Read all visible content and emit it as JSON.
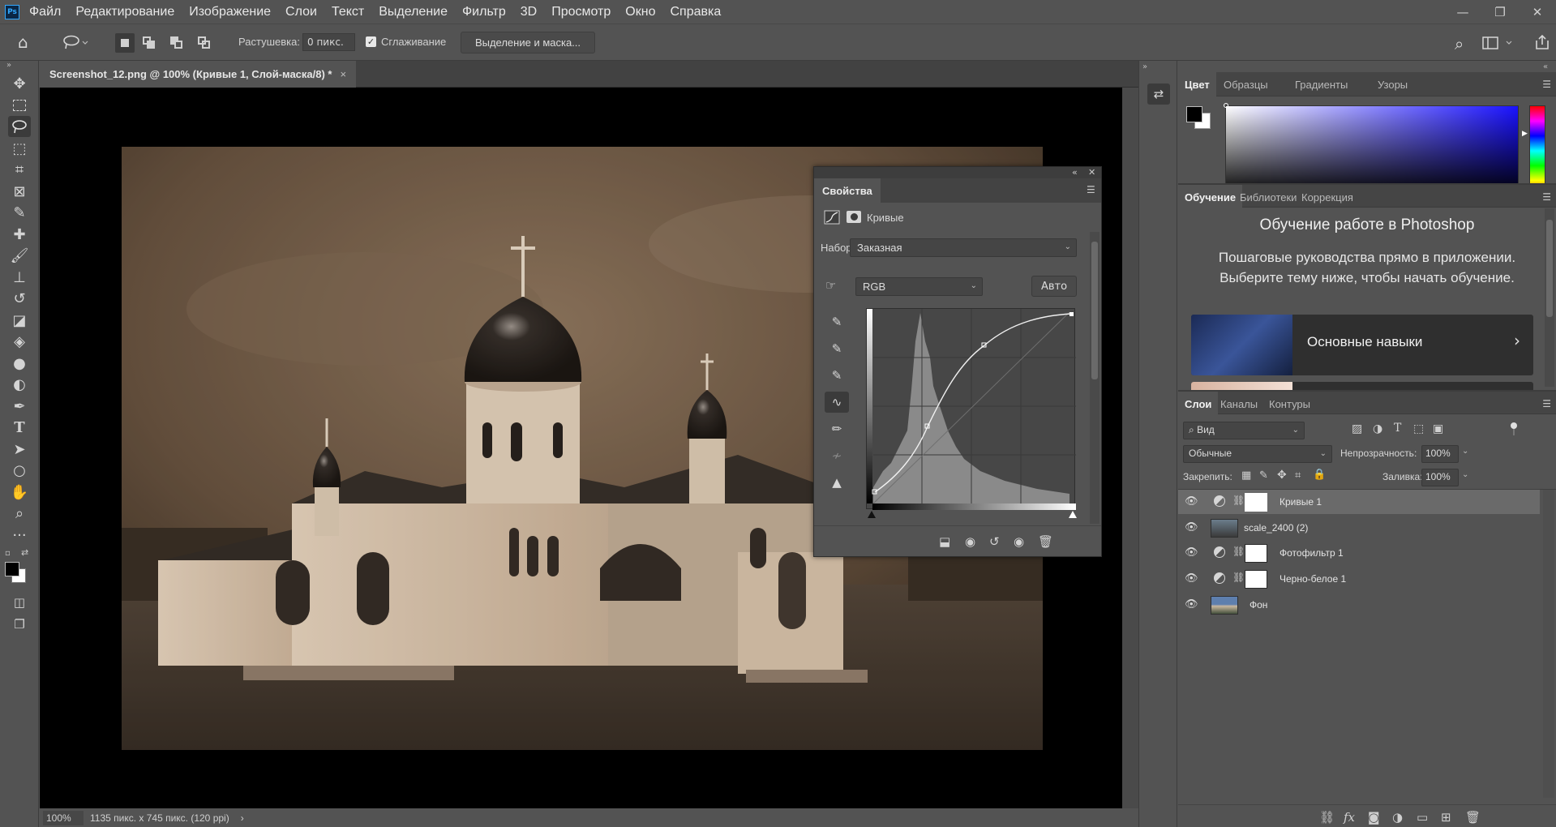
{
  "app": {
    "logo_text": "Ps"
  },
  "menu": [
    "Файл",
    "Редактирование",
    "Изображение",
    "Слои",
    "Текст",
    "Выделение",
    "Фильтр",
    "3D",
    "Просмотр",
    "Окно",
    "Справка"
  ],
  "window_controls": {
    "minimize": "—",
    "restore": "❐",
    "close": "✕"
  },
  "options": {
    "feather_label": "Растушевка:",
    "feather_value": "0 пикс.",
    "smoothing_label": "Сглаживание",
    "smoothing_checked": true,
    "select_mask_button": "Выделение и маска..."
  },
  "document": {
    "tab_title": "Screenshot_12.png @ 100% (Кривые 1, Слой-маска/8) *",
    "tab_close": "×",
    "zoom": "100%",
    "dimensions": "1135 пикс. x 745 пикс. (120 ppi)",
    "status_arrow": "›"
  },
  "properties": {
    "collapse": "«",
    "close": "✕",
    "tab": "Свойства",
    "adjustment_name": "Кривые",
    "preset_label": "Набор:",
    "preset_value": "Заказная",
    "channel_value": "RGB",
    "auto_button": "Авто"
  },
  "right_panels": {
    "color_tabs": [
      "Цвет",
      "Образцы",
      "Градиенты",
      "Узоры"
    ],
    "learn_tabs": [
      "Обучение",
      "Библиотеки",
      "Коррекция"
    ],
    "learn_title": "Обучение работе в Photoshop",
    "learn_subtitle": "Пошаговые руководства прямо в приложении. Выберите тему ниже, чтобы начать обучение.",
    "learn_card_title": "Основные навыки",
    "layers_tabs": [
      "Слои",
      "Каналы",
      "Контуры"
    ],
    "filter_kind": "Вид",
    "blend_mode": "Обычные",
    "opacity_label": "Непрозрачность:",
    "opacity_value": "100%",
    "lock_label": "Закрепить:",
    "fill_label": "Заливка:",
    "fill_value": "100%"
  },
  "layers": [
    {
      "name": "Кривые 1",
      "type": "adjustment",
      "selected": true
    },
    {
      "name": "scale_2400 (2)",
      "type": "smart-object",
      "selected": false
    },
    {
      "name": "Фотофильтр 1",
      "type": "adjustment",
      "selected": false
    },
    {
      "name": "Черно-белое 1",
      "type": "adjustment",
      "selected": false
    },
    {
      "name": "Фон",
      "type": "background",
      "selected": false
    }
  ],
  "colors": {
    "accent": "#31a8ff",
    "panel": "#535353",
    "dark": "#424242"
  }
}
